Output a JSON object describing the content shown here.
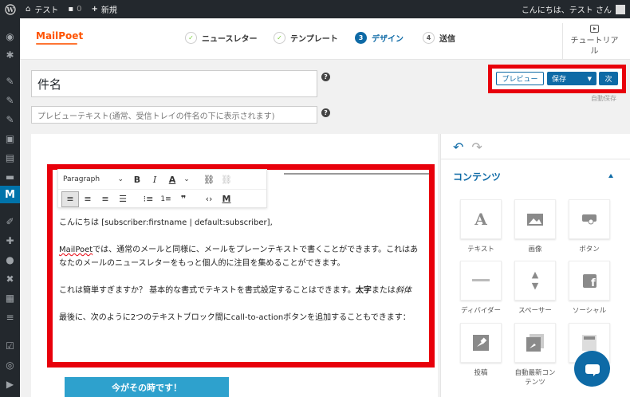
{
  "admin_bar": {
    "site_name": "テスト",
    "comments_count": "0",
    "new_label": "新規",
    "greeting": "こんにちは、テスト さん"
  },
  "logo_text": "MailPoet",
  "steps": [
    {
      "number": "✓",
      "label": "ニュースレター",
      "state": "done"
    },
    {
      "number": "✓",
      "label": "テンプレート",
      "state": "done"
    },
    {
      "number": "3",
      "label": "デザイン",
      "state": "current"
    },
    {
      "number": "4",
      "label": "送信",
      "state": "todo"
    }
  ],
  "tutorial_label": "チュートリアル",
  "subject": {
    "value": "件名"
  },
  "preheader": {
    "placeholder": "プレビューテキスト(通常、受信トレイの件名の下に表示されます)"
  },
  "help_mark": "?",
  "actions": {
    "preview_label": "プレビュー",
    "save_label": "保存",
    "next_label": "次",
    "autosave_label": "自動保存"
  },
  "toolbar": {
    "format_select": "Paragraph"
  },
  "content": {
    "line1": "こんにちは [subscriber:firstname | default:subscriber],",
    "p2_brand": "MailPoet",
    "p2_rest": "では、通常のメールと同様に、メールをプレーンテキストで書くことができます。これはあなたのメールのニュースレターをもっと個人的に注目を集めることができます。",
    "p3_start": "これは簡単すぎますか？ 基本的な書式でテキストを書式設定することはできます。",
    "p3_bold": "太字",
    "p3_mid": "または",
    "p3_italic": "斜体",
    "p4": "最後に、次のように2つのテキストブロック間にcall-to-actionボタンを追加することもできます："
  },
  "cta_label": "今がその時です！",
  "sidebar": {
    "heading": "コンテンツ",
    "widgets": [
      {
        "label": "テキスト",
        "icon": "text-icon"
      },
      {
        "label": "画像",
        "icon": "image-icon"
      },
      {
        "label": "ボタン",
        "icon": "button-icon"
      },
      {
        "label": "ディバイダー",
        "icon": "divider-icon"
      },
      {
        "label": "スペーサー",
        "icon": "spacer-icon"
      },
      {
        "label": "ソーシャル",
        "icon": "social-icon"
      },
      {
        "label": "投稿",
        "icon": "posts-icon"
      },
      {
        "label": "自動最新コンテンツ",
        "icon": "auto-latest-content-icon"
      },
      {
        "label": "ヘ",
        "icon": "header-icon"
      }
    ]
  },
  "colors": {
    "accent": "#0e6aa6",
    "highlight_red": "#e8000b",
    "cta": "#2ea1cd",
    "brand_orange": "#fe5301"
  }
}
